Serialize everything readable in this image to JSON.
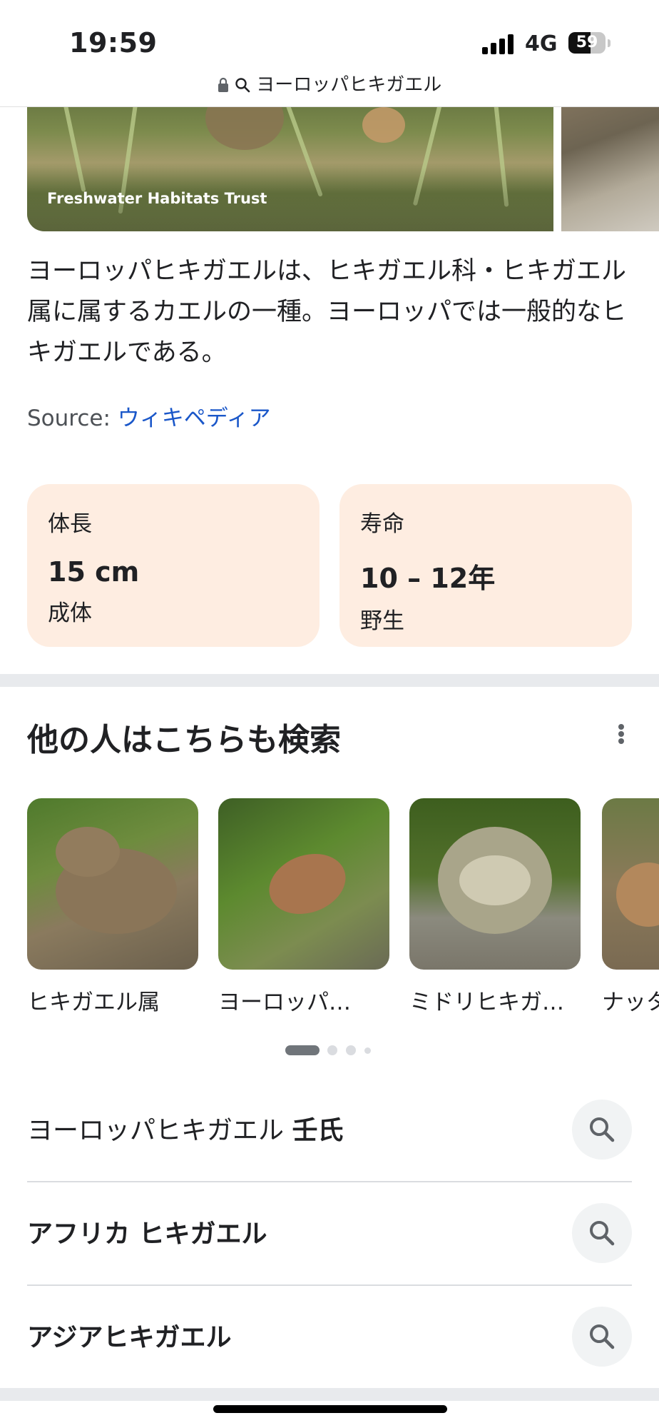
{
  "status_bar": {
    "time": "19:59",
    "network": "4G",
    "battery": "59",
    "battery_level": 0.59
  },
  "address_bar": {
    "query": "ヨーロッパヒキガエル"
  },
  "image_strip": {
    "caption": "Freshwater Habitats Trust"
  },
  "description": {
    "text": "ヨーロッパヒキガエルは、ヒキガエル科・ヒキガエル属に属するカエルの一種。ヨーロッパでは一般的なヒキガエルである。",
    "source_label": "Source:",
    "source_link": "ウィキペディア"
  },
  "facts": [
    {
      "label": "体長",
      "value": "15 cm",
      "sub": "成体"
    },
    {
      "label": "寿命",
      "value": "10 – 12年",
      "sub": "野生"
    }
  ],
  "others_searched": {
    "title": "他の人はこちらも検索",
    "more_icon": "more-vert-icon",
    "items": [
      {
        "label": "ヒキガエル属"
      },
      {
        "label": "ヨーロッパ…"
      },
      {
        "label": "ミドリヒキガ…"
      },
      {
        "label": "ナッタ"
      }
    ],
    "page_indicator": {
      "pages": 4,
      "current": 1
    }
  },
  "related_searches": [
    {
      "prefix": "ヨーロッパヒキガエル",
      "bold": "壬氏",
      "icon": "search-icon"
    },
    {
      "prefix": "",
      "bold": "アフリカ ヒキガエル",
      "icon": "search-icon"
    },
    {
      "prefix": "",
      "bold": "アジアヒキガエル",
      "icon": "search-icon"
    }
  ],
  "colors": {
    "fact_card_bg": "#feede1",
    "link": "#1a57c9",
    "divider": "#e8eaed",
    "search_button_bg": "#f1f3f4"
  }
}
